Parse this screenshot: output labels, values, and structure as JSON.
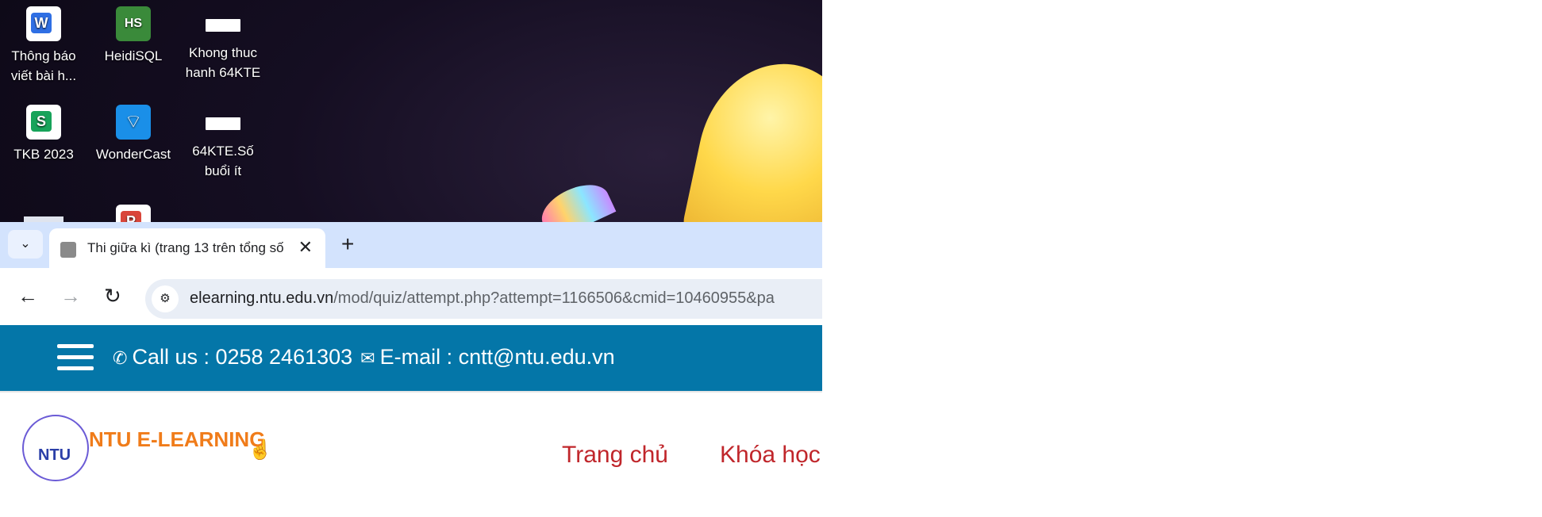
{
  "desktop": {
    "icons": [
      {
        "label": "Thông báo viết bài h...",
        "icon": "wps-writer-icon"
      },
      {
        "label": "HeidiSQL",
        "icon": "heidisql-icon"
      },
      {
        "label": "Khong thuc hanh 64KTE",
        "icon": "image-thumbnail-icon"
      },
      {
        "label": "TKB 2023",
        "icon": "wps-spreadsheet-icon"
      },
      {
        "label": "WonderCast",
        "icon": "wondercast-icon"
      },
      {
        "label": "64KTE.Số buổi ít",
        "icon": "image-thumbnail-icon"
      }
    ]
  },
  "browser": {
    "tab_title": "Thi giữa kì (trang 13 trên tổng số",
    "url_domain": "elearning.ntu.edu.vn",
    "url_path": "/mod/quiz/attempt.php?attempt=1166506&cmid=10460955&pa"
  },
  "site": {
    "call_text": "Call us : 0258 2461303",
    "email_text": "E-mail : cntt@ntu.edu.vn",
    "logo_abbr": "NTU",
    "logo_text": "NTU E-LEARNING",
    "menu": [
      "Trang chủ",
      "Khóa học"
    ]
  },
  "colors": {
    "header_bg": "#0476a8",
    "menu_link": "#c0262b",
    "logo_orange": "#f07c1a",
    "tabstrip": "#d3e3fd"
  }
}
